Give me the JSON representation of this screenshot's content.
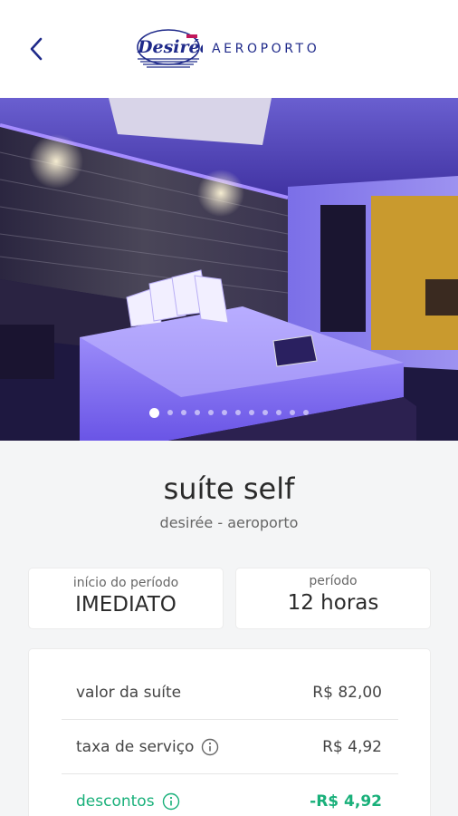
{
  "header": {
    "back_icon": "chevron-left-icon",
    "logo_text": "Desirée",
    "location": "AEROPORTO",
    "brand_color": "#1f2a8a"
  },
  "gallery": {
    "slide_count": 12,
    "active_index": 0
  },
  "suite": {
    "title": "suíte self",
    "subtitle": "desirée - aeroporto"
  },
  "period_start": {
    "label": "início do período",
    "value": "IMEDIATO"
  },
  "period_length": {
    "label": "período",
    "value": "12 horas"
  },
  "pricing": {
    "rows": [
      {
        "label": "valor da suíte",
        "value": "R$ 82,00"
      },
      {
        "label": "taxa de serviço",
        "value": "R$ 4,92",
        "info_icon": "info-icon"
      },
      {
        "label": "descontos",
        "value": "-R$ 4,92",
        "info_icon": "info-icon"
      }
    ],
    "discount_color": "#19b07a"
  }
}
